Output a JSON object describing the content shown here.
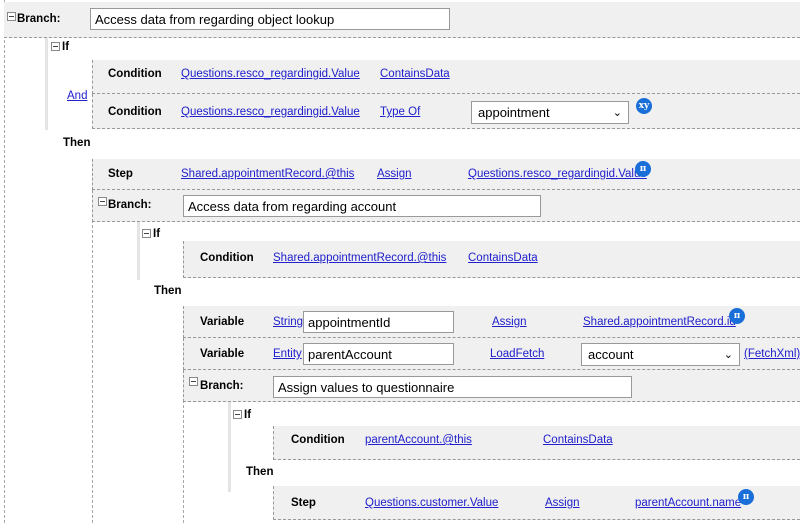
{
  "branch1": {
    "label": "Branch:",
    "value": "Access data from regarding object lookup"
  },
  "if1": {
    "label": "If",
    "operator": "And",
    "conditions": [
      {
        "label": "Condition",
        "field": "Questions.resco_regardingid.Value",
        "op": "ContainsData"
      },
      {
        "label": "Condition",
        "field": "Questions.resco_regardingid.Value",
        "op": "Type Of",
        "value": "appointment",
        "icon": "xy-icon",
        "icon_text": "xy"
      }
    ]
  },
  "then1": {
    "label": "Then",
    "step": {
      "label": "Step",
      "target": "Shared.appointmentRecord.@this",
      "op": "Assign",
      "source": "Questions.resco_regardingid.Value",
      "icon_text": "π"
    }
  },
  "branch2": {
    "label": "Branch:",
    "value": "Access data from regarding account"
  },
  "if2": {
    "label": "If",
    "condition": {
      "label": "Condition",
      "field": "Shared.appointmentRecord.@this",
      "op": "ContainsData"
    }
  },
  "then2": {
    "label": "Then",
    "var1": {
      "label": "Variable",
      "type": "String",
      "name": "appointmentId",
      "op": "Assign",
      "source": "Shared.appointmentRecord.id",
      "icon_text": "π"
    },
    "var2": {
      "label": "Variable",
      "type": "Entity",
      "name": "parentAccount",
      "op": "LoadFetch",
      "entity": "account",
      "extra": "(FetchXml)"
    }
  },
  "branch3": {
    "label": "Branch:",
    "value": "Assign values to questionnaire"
  },
  "if3": {
    "label": "If",
    "condition": {
      "label": "Condition",
      "field": "parentAccount.@this",
      "op": "ContainsData"
    }
  },
  "then3": {
    "label": "Then",
    "step": {
      "label": "Step",
      "target": "Questions.customer.Value",
      "op": "Assign",
      "source": "parentAccount.name",
      "icon_text": "π"
    }
  }
}
